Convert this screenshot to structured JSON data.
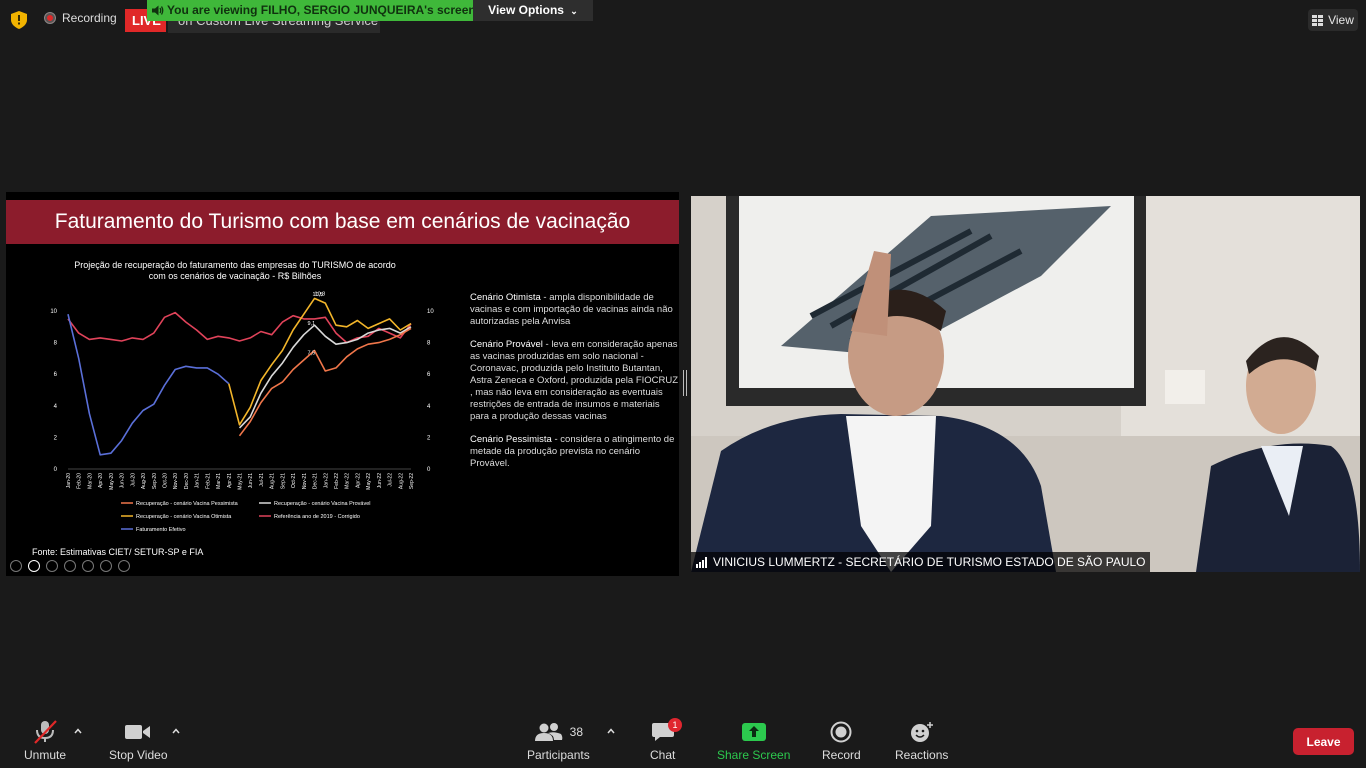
{
  "top": {
    "recording_label": "Recording",
    "live_badge": "LIVE",
    "stream_text": "on Custom Live Streaming Service",
    "viewing_banner": "You are viewing FILHO, SERGIO JUNQUEIRA's screen",
    "view_options": "View Options",
    "view_button": "View"
  },
  "slide": {
    "title": "Faturamento do Turismo com base em cenários de vacinação",
    "chart_title": "Projeção de recuperação do faturamento das empresas do TURISMO de acordo com os cenários de vacinação - R$ Bilhões",
    "scenarios": [
      {
        "name": "Cenário Otimista",
        "text": " - ampla disponibilidade de vacinas e com importação de vacinas ainda não autorizadas pela Anvisa"
      },
      {
        "name": "Cenário Provável",
        "text": " -  leva em consideração apenas as vacinas produzidas em solo nacional - Coronavac, produzida pelo Instituto Butantan, Astra Zeneca e Oxford, produzida pela FIOCRUZ , mas não leva em consideração as eventuais restrições de entrada de insumos e materiais para a produção dessas vacinas"
      },
      {
        "name": "Cenário Pessimista",
        "text": " -  considera o atingimento de metade da produção prevista no cenário Provável."
      }
    ],
    "source": "Fonte: Estimativas CIET/ SETUR-SP e FIA"
  },
  "chart_data": {
    "type": "line",
    "title": "Projeção de recuperação do faturamento das empresas do TURISMO de acordo com os cenários de vacinação - R$ Bilhões",
    "categories": [
      "Jan-20",
      "Feb-20",
      "Mar-20",
      "Apr-20",
      "May-20",
      "Jun-20",
      "Jul-20",
      "Aug-20",
      "Sep-20",
      "Oct-20",
      "Nov-20",
      "Dec-20",
      "Jan-21",
      "Feb-21",
      "Mar-21",
      "Apr-21",
      "May-21",
      "Jun-21",
      "Jul-21",
      "Aug-21",
      "Sep-21",
      "Oct-21",
      "Nov-21",
      "Dec-21",
      "Jan-22",
      "Feb-22",
      "Mar-22",
      "Apr-22",
      "May-22",
      "Jun-22",
      "Jul-22",
      "Aug-22",
      "Sep-22"
    ],
    "ylim": [
      0,
      10
    ],
    "yticks": [
      0,
      2,
      4,
      6,
      8,
      10
    ],
    "series": [
      {
        "name": "Referência ano de 2019 - Corrigido",
        "color": "#e0435a",
        "values": [
          9.5,
          8.6,
          8.2,
          8.3,
          8.2,
          8.1,
          8.3,
          8.2,
          8.6,
          9.6,
          9.9,
          9.3,
          8.8,
          8.2,
          8.4,
          8.3,
          8.1,
          8.3,
          8.7,
          8.5,
          9.3,
          9.7,
          9.5,
          9.5,
          9.6,
          8.6,
          8.0,
          8.3,
          8.4,
          8.9,
          8.6,
          8.3,
          9.2
        ]
      },
      {
        "name": "Faturamento Efetivo",
        "color": "#5a6fd8",
        "values": [
          9.8,
          7.0,
          3.5,
          0.9,
          1.0,
          1.8,
          2.9,
          3.7,
          4.1,
          5.3,
          6.3,
          6.5,
          6.4,
          6.4,
          6.0,
          5.4,
          null,
          null,
          null,
          null,
          null,
          null,
          null,
          null,
          null,
          null,
          null,
          null,
          null,
          null,
          null,
          null,
          null
        ]
      },
      {
        "name": "Recuperação - cenário Vacina Otimista",
        "color": "#f2b52a",
        "values": [
          null,
          null,
          null,
          null,
          null,
          null,
          null,
          null,
          null,
          null,
          null,
          null,
          null,
          null,
          null,
          5.4,
          2.8,
          3.9,
          5.6,
          6.6,
          7.5,
          8.8,
          9.8,
          10.8,
          10.5,
          9.1,
          9.0,
          9.4,
          8.9,
          9.2,
          9.5,
          8.8,
          9.2
        ]
      },
      {
        "name": "Recuperação - cenário Vacina Provável",
        "color": "#d9d9d9",
        "values": [
          null,
          null,
          null,
          null,
          null,
          null,
          null,
          null,
          null,
          null,
          null,
          null,
          null,
          null,
          null,
          null,
          2.6,
          3.3,
          4.8,
          5.9,
          6.7,
          7.7,
          8.5,
          9.1,
          8.4,
          7.9,
          8.0,
          8.2,
          8.6,
          8.8,
          8.9,
          8.6,
          9.0
        ]
      },
      {
        "name": "Recuperação - cenário Vacina Pessimista",
        "color": "#f0764a",
        "values": [
          null,
          null,
          null,
          null,
          null,
          null,
          null,
          null,
          null,
          null,
          null,
          null,
          null,
          null,
          null,
          null,
          2.1,
          3.0,
          4.2,
          5.1,
          5.5,
          6.3,
          6.9,
          7.5,
          6.2,
          6.4,
          7.1,
          7.6,
          7.9,
          8.0,
          8.2,
          8.5,
          8.9
        ]
      }
    ],
    "annotations": [
      "10,8",
      "10,5",
      "9,1",
      "7,5"
    ],
    "legend": [
      "Recuperação - cenário Vacina Pessimista",
      "Recuperação - cenário Vacina Provável",
      "Recuperação - cenário Vacina Otimista",
      "Referência ano de 2019 - Corrigido",
      "Faturamento Efetivo"
    ]
  },
  "video": {
    "participant_name": "VINICIUS LUMMERTZ - SECRETÁRIO DE TURISMO ESTADO DE SÃO PAULO"
  },
  "toolbar": {
    "unmute": "Unmute",
    "stop_video": "Stop Video",
    "participants": "Participants",
    "participants_count": "38",
    "chat": "Chat",
    "chat_badge": "1",
    "share_screen": "Share Screen",
    "record": "Record",
    "reactions": "Reactions",
    "leave": "Leave"
  }
}
